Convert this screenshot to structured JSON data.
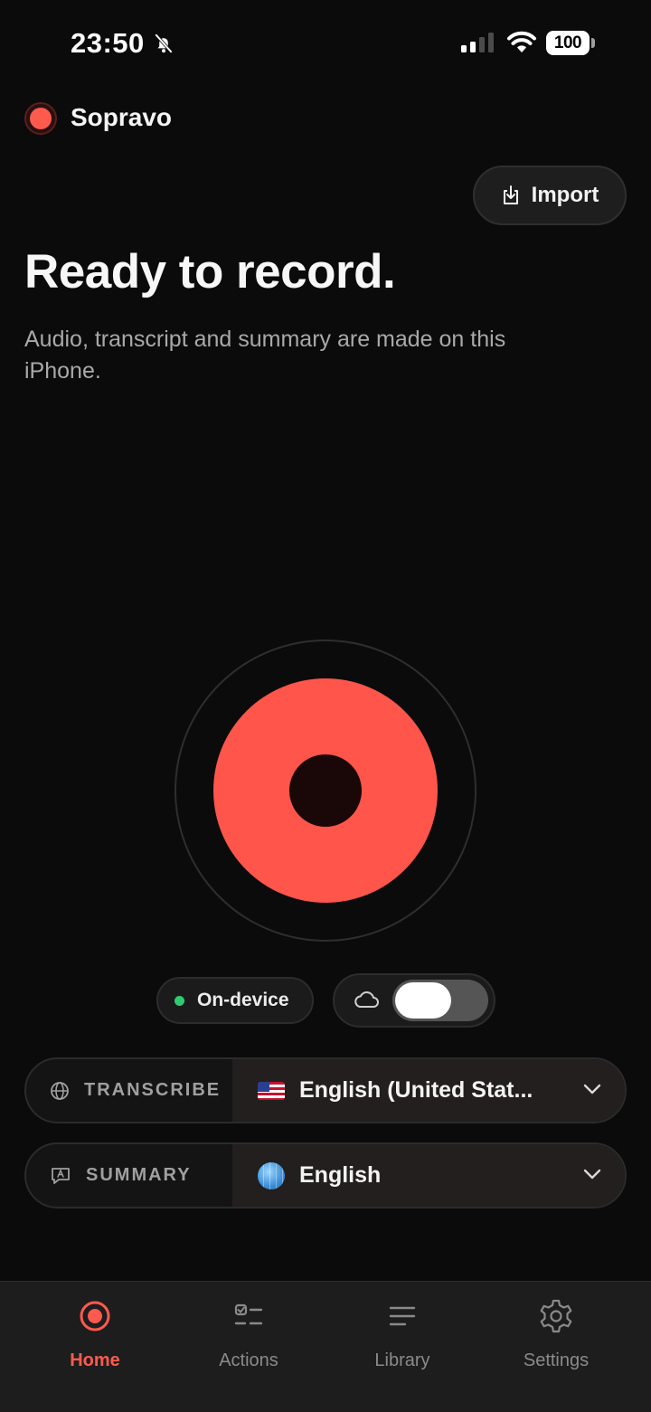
{
  "status_bar": {
    "time": "23:50",
    "battery": "100"
  },
  "app": {
    "name": "Sopravo",
    "accent": "#ff554a"
  },
  "header": {
    "import_label": "Import"
  },
  "hero": {
    "title": "Ready to record.",
    "subtitle": "Audio, transcript and summary are made on this iPhone."
  },
  "mode": {
    "on_device_label": "On-device",
    "cloud_toggle_on": false
  },
  "transcribe": {
    "label": "TRANSCRIBE",
    "value": "English (United Stat..."
  },
  "summary": {
    "label": "SUMMARY",
    "value": "English"
  },
  "tabs": [
    {
      "label": "Home",
      "icon": "record-icon",
      "active": true
    },
    {
      "label": "Actions",
      "icon": "checklist-icon",
      "active": false
    },
    {
      "label": "Library",
      "icon": "list-icon",
      "active": false
    },
    {
      "label": "Settings",
      "icon": "gear-icon",
      "active": false
    }
  ]
}
